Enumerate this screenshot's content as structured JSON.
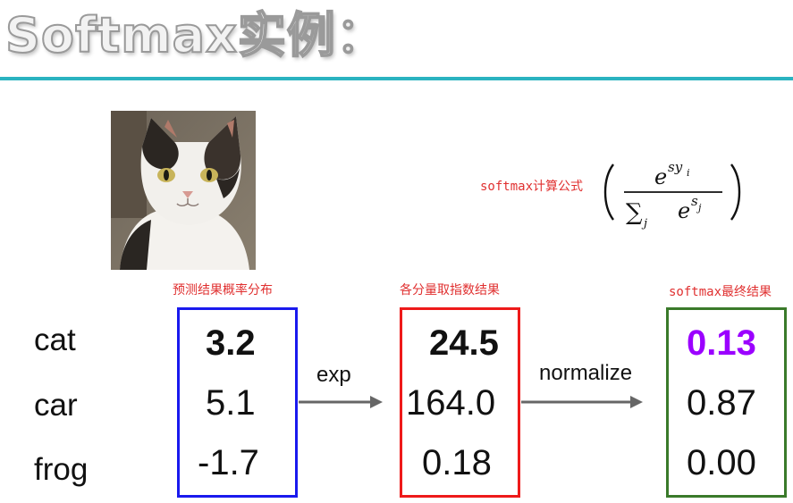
{
  "title": "Softmax实例：",
  "formula": {
    "label": "softmax计算公式",
    "numerator_base": "e",
    "numerator_exp": "sy",
    "numerator_sub": "i",
    "sum_symbol": "∑",
    "sum_index": "j",
    "denominator_base": "e",
    "denominator_exp": "s",
    "denominator_sub": "j"
  },
  "classes": [
    "cat",
    "car",
    "frog"
  ],
  "boxes": {
    "scores": {
      "label": "预测结果概率分布",
      "values": [
        "3.2",
        "5.1",
        "-1.7"
      ],
      "color": "#1a1aee"
    },
    "exp": {
      "label": "各分量取指数结果",
      "values": [
        "24.5",
        "164.0",
        "0.18"
      ],
      "color": "#ee1a1a"
    },
    "probs": {
      "label": "softmax最终结果",
      "values": [
        "0.13",
        "0.87",
        "0.00"
      ],
      "color": "#3a7a2a",
      "highlight_color": "#9b00ff"
    }
  },
  "operations": {
    "exp": "exp",
    "normalize": "normalize"
  }
}
